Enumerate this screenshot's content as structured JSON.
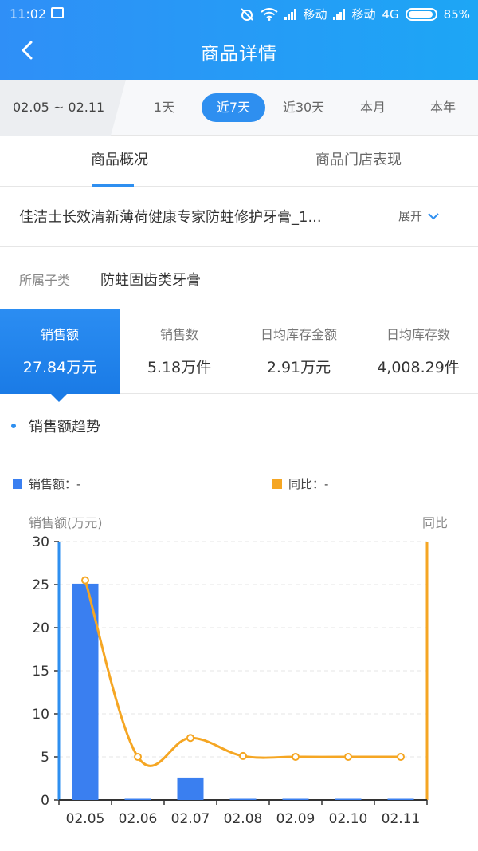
{
  "status_bar": {
    "time": "11:02",
    "carrier1": "移动",
    "carrier2": "移动",
    "network": "4G",
    "battery": "85%"
  },
  "header": {
    "title": "商品详情"
  },
  "filter": {
    "date_range": "02.05 ~ 02.11",
    "periods": [
      {
        "label": "1天",
        "active": false
      },
      {
        "label": "近7天",
        "active": true
      },
      {
        "label": "近30天",
        "active": false
      },
      {
        "label": "本月",
        "active": false
      },
      {
        "label": "本年",
        "active": false
      }
    ]
  },
  "tabs": [
    {
      "label": "商品概况",
      "active": true
    },
    {
      "label": "商品门店表现",
      "active": false
    }
  ],
  "product": {
    "name": "佳洁士长效清新薄荷健康专家防蛀修护牙膏_1...",
    "expand_label": "展开"
  },
  "subcategory": {
    "label": "所属子类",
    "value": "防蛀固齿类牙膏"
  },
  "metrics": [
    {
      "label": "销售额",
      "value": "27.84万元",
      "active": true
    },
    {
      "label": "销售数",
      "value": "5.18万件",
      "active": false
    },
    {
      "label": "日均库存金额",
      "value": "2.91万元",
      "active": false
    },
    {
      "label": "日均库存数",
      "value": "4,008.29件",
      "active": false
    }
  ],
  "trend": {
    "title": "销售额趋势"
  },
  "legend": {
    "sales": "销售额：-",
    "yoy": "同比：-"
  },
  "colors": {
    "primary": "#2e8ff0",
    "bar": "#3a7ff0",
    "line": "#f5a623"
  },
  "chart_data": {
    "type": "bar",
    "categories": [
      "02.05",
      "02.06",
      "02.07",
      "02.08",
      "02.09",
      "02.10",
      "02.11"
    ],
    "ylabel": "销售额(万元)",
    "y2label": "同比",
    "ylim": [
      0,
      30
    ],
    "yticks": [
      0,
      5,
      10,
      15,
      20,
      25,
      30
    ],
    "grid": true,
    "series": [
      {
        "name": "销售额",
        "type": "bar",
        "values": [
          25.1,
          0.05,
          2.6,
          0.1,
          0.05,
          0.05,
          0.1
        ]
      },
      {
        "name": "同比",
        "type": "line",
        "axis": "right",
        "values": [
          25.5,
          5.0,
          7.2,
          5.1,
          5.0,
          5.0,
          5.0
        ]
      }
    ]
  }
}
